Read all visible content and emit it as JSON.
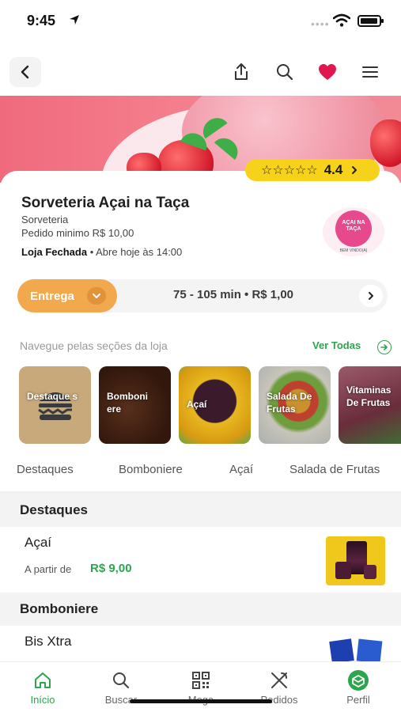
{
  "status_bar": {
    "time": "9:45"
  },
  "store": {
    "name": "Sorveteria Açai na Taça",
    "category": "Sorveteria",
    "min_order": "Pedido minimo R$ 10,00",
    "status_bold": "Loja Fechada",
    "status_rest": " • Abre hoje às 14:00",
    "rating": "4.4",
    "rating_stars": "☆☆☆☆☆",
    "logo_text": "AÇAI NA TAÇA",
    "logo_sub": "BEM VINDO(A)"
  },
  "delivery": {
    "mode_label": "Entrega",
    "info": "75 - 105 min • R$ 1,00"
  },
  "sections_nav": {
    "title": "Navegue pelas seções da loja",
    "see_all": "Ver Todas",
    "tiles": [
      {
        "label": "Destaque s"
      },
      {
        "label": "Bomboni ere"
      },
      {
        "label": "Açaí"
      },
      {
        "label": "Salada De Frutas"
      },
      {
        "label": "Vitaminas De Frutas"
      }
    ],
    "tabs": [
      "Destaques",
      "Bomboniere",
      "Açaí",
      "Salada de Frutas"
    ]
  },
  "menu": {
    "sections": [
      {
        "title": "Destaques",
        "items": [
          {
            "name": "Açaí",
            "price_label": "A partir de",
            "price": "R$ 9,00"
          }
        ]
      },
      {
        "title": "Bomboniere",
        "items": [
          {
            "name": "Bis Xtra"
          }
        ]
      }
    ]
  },
  "tabbar": {
    "items": [
      {
        "label": "Início"
      },
      {
        "label": "Buscar"
      },
      {
        "label": "Mega"
      },
      {
        "label": "Pedidos"
      },
      {
        "label": "Perfil"
      }
    ]
  },
  "colors": {
    "accent_green": "#2ea44f",
    "delivery_orange": "#f2a84d",
    "rating_yellow": "#f7d21a",
    "favorite_red": "#e0184f"
  }
}
